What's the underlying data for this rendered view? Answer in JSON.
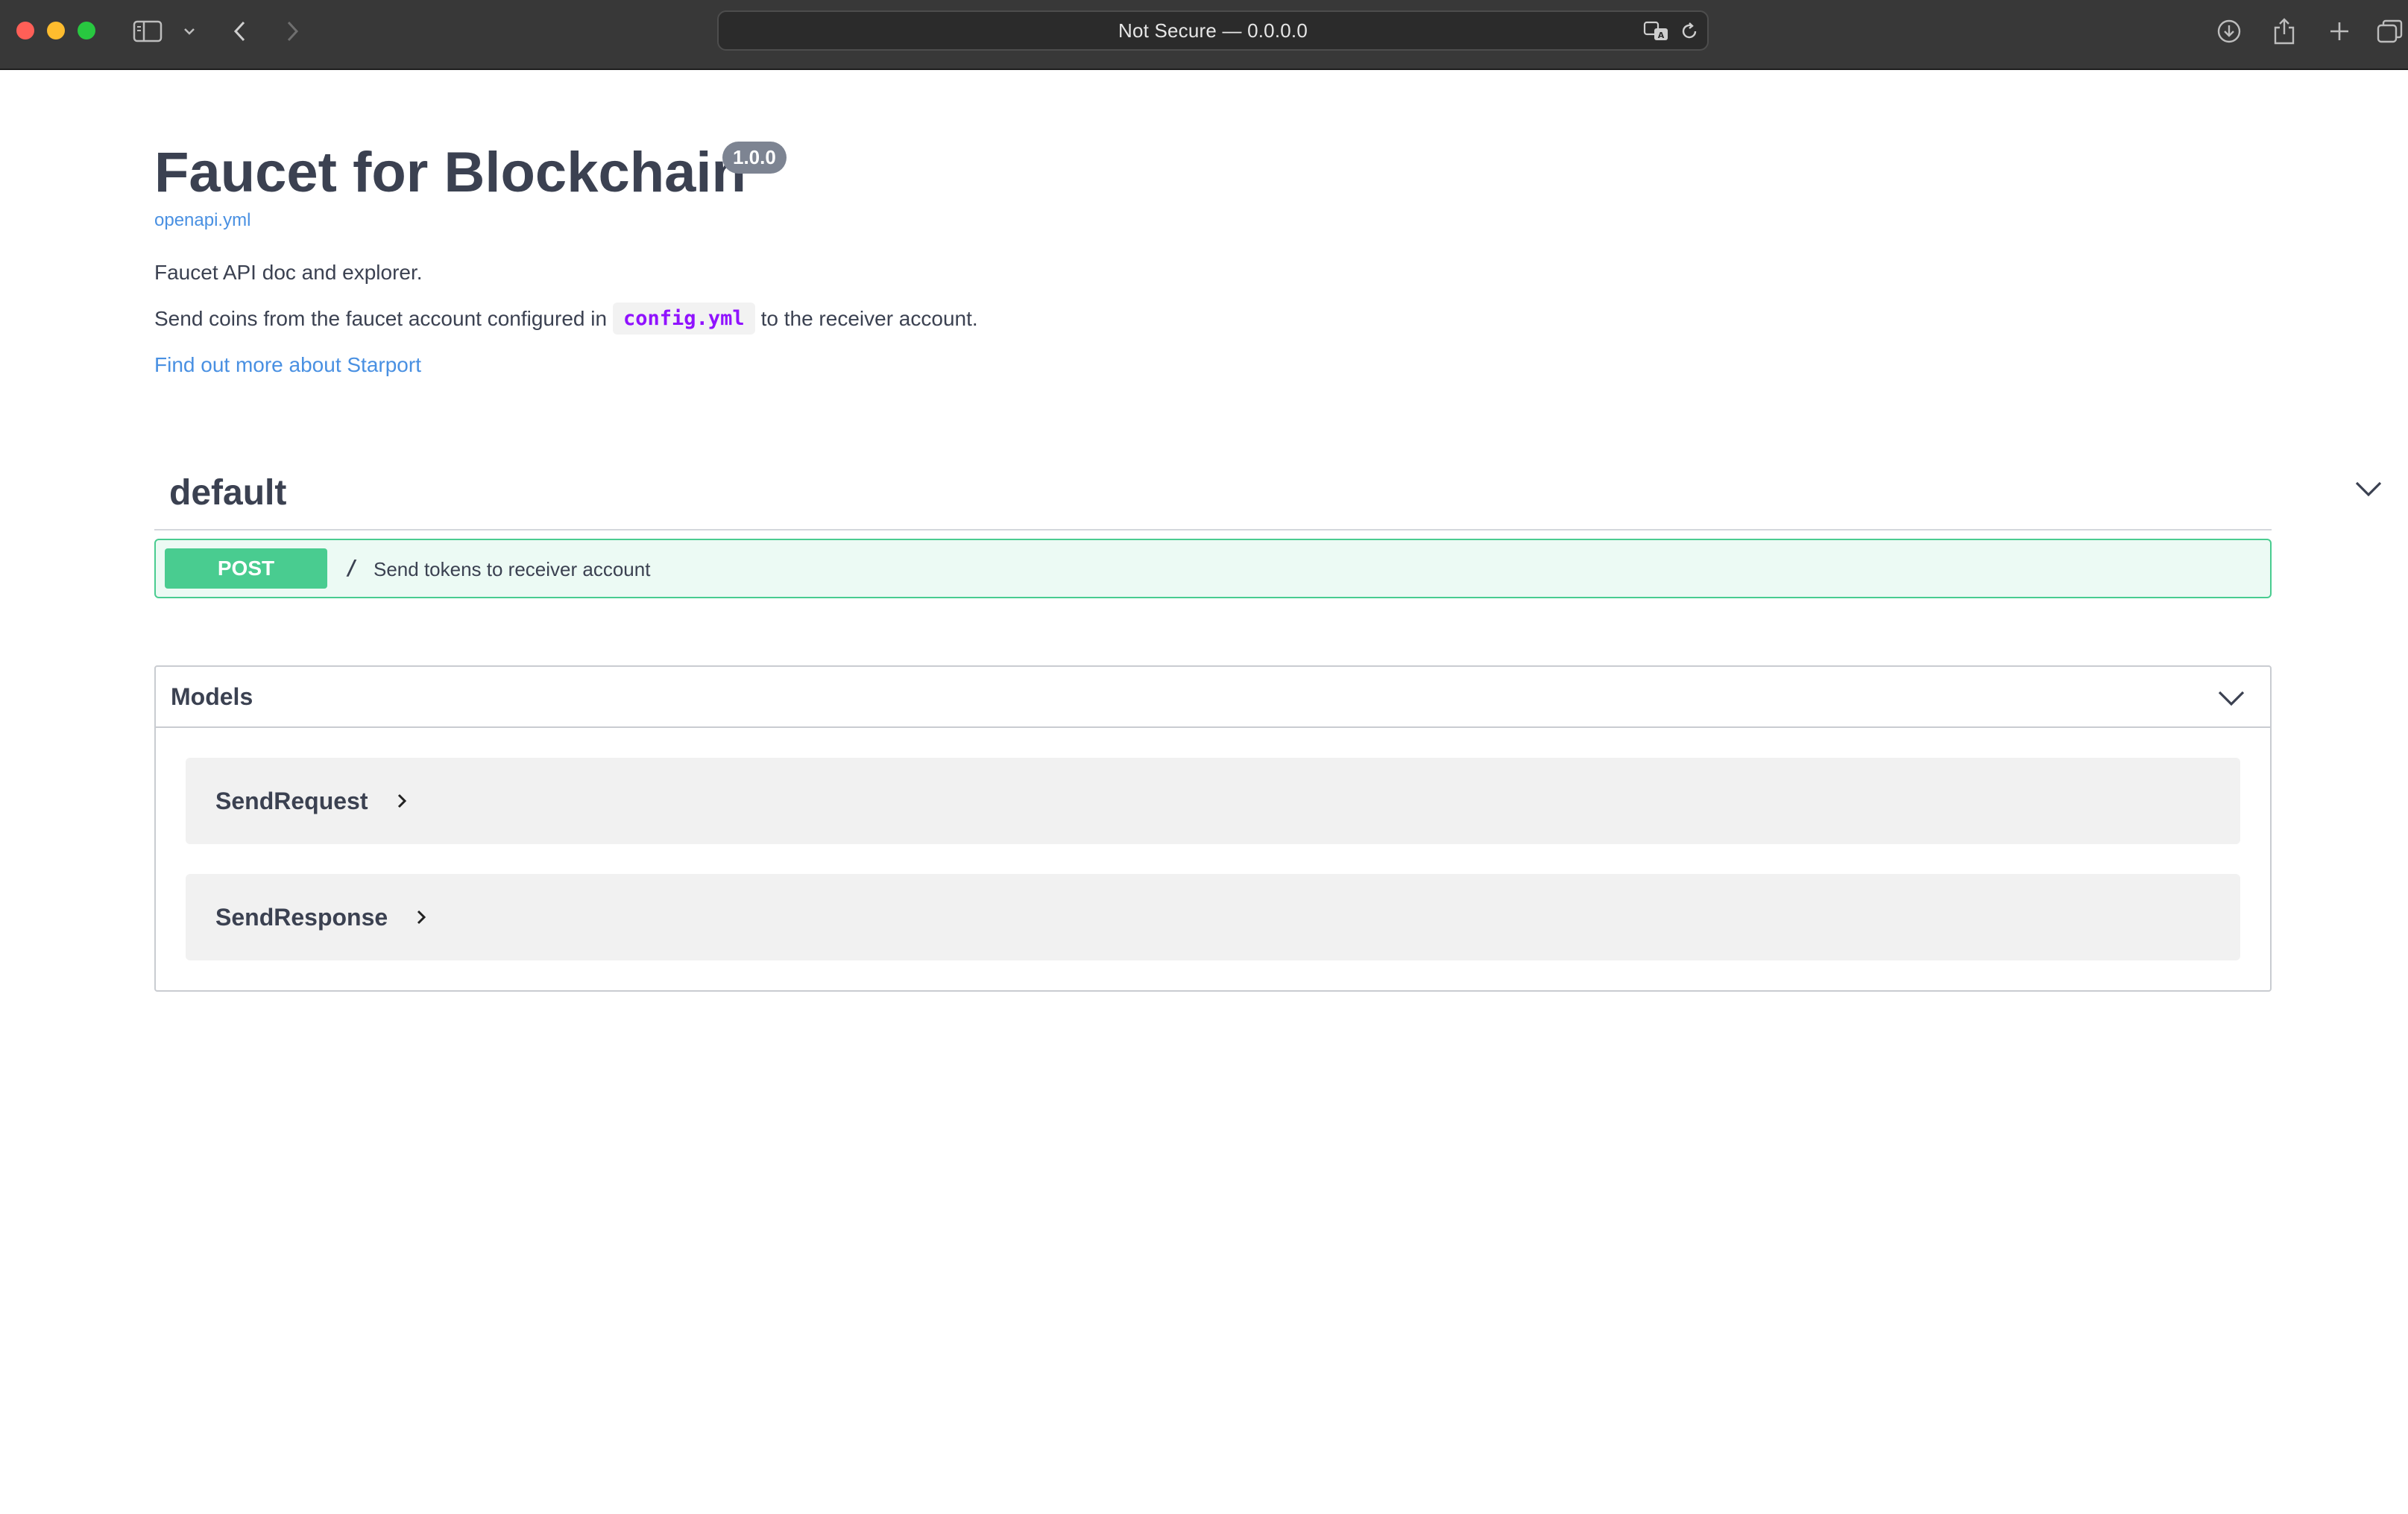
{
  "browser": {
    "address_text": "Not Secure — 0.0.0.0",
    "icons": [
      "sidebar-icon",
      "chevron-down-icon",
      "back-icon",
      "forward-icon",
      "translate-icon",
      "reload-icon",
      "download-icon",
      "share-icon",
      "new-tab-icon",
      "tabs-overview-icon"
    ]
  },
  "info": {
    "title": "Faucet for Blockchain",
    "version": "1.0.0",
    "spec_link": "openapi.yml",
    "description_line1": "Faucet API doc and explorer.",
    "description_line2_before": "Send coins from the faucet account configured in",
    "description_line2_code": "config.yml",
    "description_line2_after": "to the receiver account.",
    "external_link": "Find out more about Starport"
  },
  "tag": {
    "name": "default"
  },
  "operation": {
    "method": "POST",
    "path": "/",
    "summary": "Send tokens to receiver account"
  },
  "models": {
    "title": "Models",
    "items": [
      {
        "name": "SendRequest"
      },
      {
        "name": "SendResponse"
      }
    ]
  },
  "colors": {
    "post": "#49cc90",
    "link": "#4990e2",
    "code": "#9012fe",
    "text": "#3b4151",
    "toolbar": "#383838"
  }
}
